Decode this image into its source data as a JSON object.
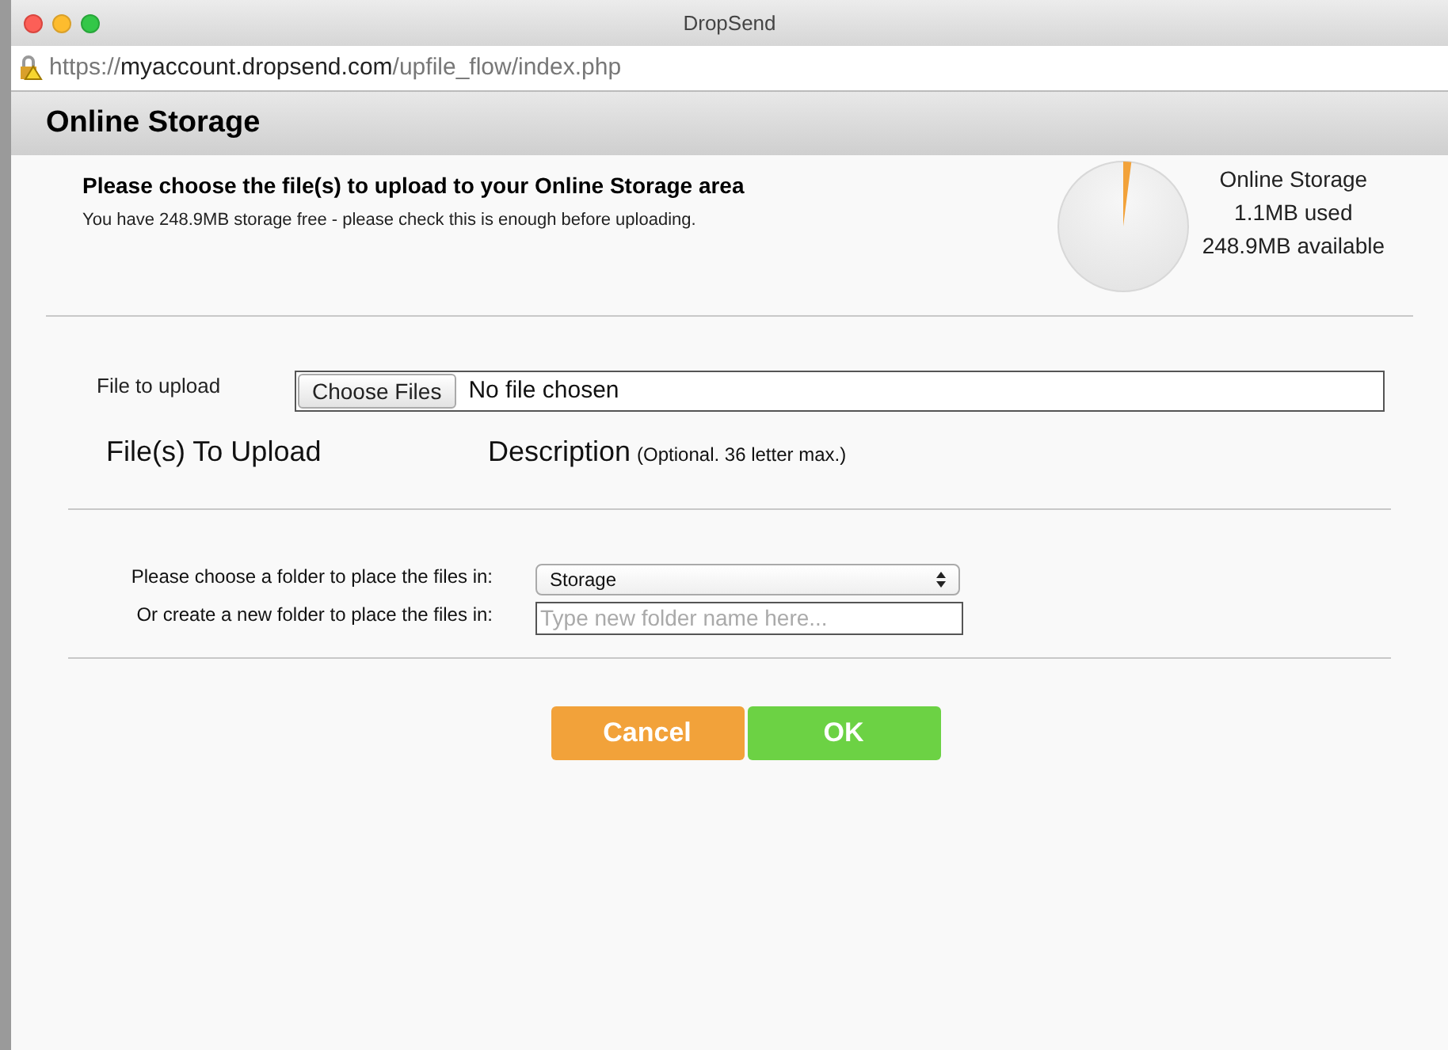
{
  "window": {
    "title": "DropSend"
  },
  "address_bar": {
    "scheme": "https://",
    "host": "myaccount.dropsend.com",
    "path": "/upfile_flow/index.php"
  },
  "header": {
    "title": "Online Storage"
  },
  "intro": {
    "heading": "Please choose the file(s) to upload to your Online Storage area",
    "note": "You have 248.9MB storage free - please check this is enough before uploading."
  },
  "storage": {
    "title": "Online Storage",
    "used": "1.1MB used",
    "available": "248.9MB available"
  },
  "upload": {
    "label": "File to upload",
    "button": "Choose Files",
    "status": "No file chosen"
  },
  "columns": {
    "files": "File(s) To Upload",
    "description": "Description",
    "description_hint": "(Optional. 36 letter max.)"
  },
  "folder": {
    "choose_label": "Please choose a folder to place the files in:",
    "selected": "Storage",
    "create_label": "Or create a new folder to place the files in:",
    "placeholder": "Type new folder name here..."
  },
  "buttons": [
    {
      "kind": "cancel",
      "label": "Cancel"
    },
    {
      "kind": "ok",
      "label": "OK"
    }
  ]
}
